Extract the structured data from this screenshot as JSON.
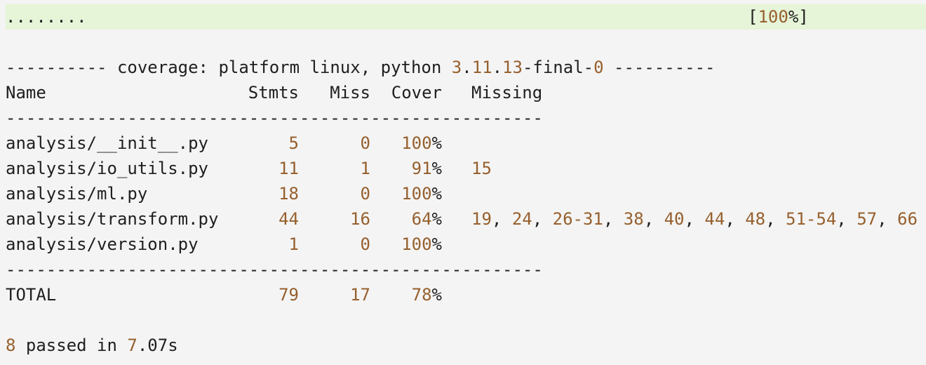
{
  "progress": {
    "dots": "........",
    "percent_open": "[",
    "percent_value": "100",
    "percent_close": "%]"
  },
  "coverage_header": {
    "rule_left": "----------",
    "text1": " coverage: platform linux, python ",
    "ver_major": "3",
    "dot1": ".",
    "ver_minor": "11",
    "dot2": ".",
    "ver_patch": "13",
    "suffix": "-final-",
    "suffix_num": "0",
    "rule_right": " ----------"
  },
  "table": {
    "headers": [
      "Name",
      "Stmts",
      "Miss",
      "Cover",
      "Missing"
    ],
    "separator": "-----------------------------------------------------",
    "rows": [
      {
        "name": "analysis/__init__.py",
        "stmts": "5",
        "miss": "0",
        "cover": "100",
        "missing": ""
      },
      {
        "name": "analysis/io_utils.py",
        "stmts": "11",
        "miss": "1",
        "cover": "91",
        "missing": "15"
      },
      {
        "name": "analysis/ml.py",
        "stmts": "18",
        "miss": "0",
        "cover": "100",
        "missing": ""
      },
      {
        "name": "analysis/transform.py",
        "stmts": "44",
        "miss": "16",
        "cover": "64",
        "missing": "19, 24, 26-31, 38, 40, 44, 48, 51-54, 57, 66"
      },
      {
        "name": "analysis/version.py",
        "stmts": "1",
        "miss": "0",
        "cover": "100",
        "missing": ""
      }
    ],
    "total": {
      "name": "TOTAL",
      "stmts": "79",
      "miss": "17",
      "cover": "78"
    }
  },
  "summary": {
    "passed_count": "8",
    "passed_text": " passed in ",
    "time_int": "7",
    "time_rest": ".07s"
  },
  "colors": {
    "number": "#96602e",
    "progress_bg": "#e6f4d8",
    "background": "#f4f4f4"
  }
}
